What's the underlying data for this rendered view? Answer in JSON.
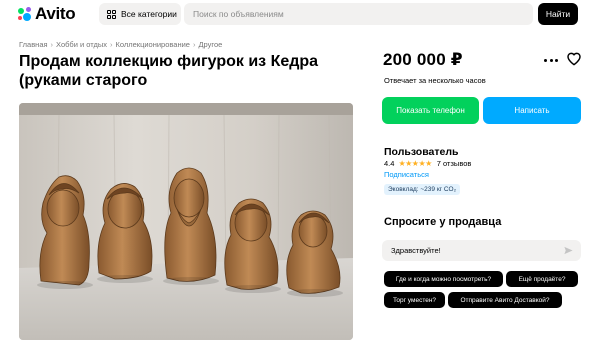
{
  "header": {
    "logo_text": "Avito",
    "categories_label": "Все категории",
    "search_placeholder": "Поиск по объявлениям",
    "find_label": "Найти"
  },
  "breadcrumbs": [
    "Главная",
    "Хобби и отдых",
    "Коллекционирование",
    "Другое"
  ],
  "listing": {
    "title": "Продам коллекцию фигурок из Кедра (руками старого"
  },
  "sidebar": {
    "price": "200 000 ₽",
    "response_time": "Отвечает за несколько часов",
    "show_phone_label": "Показать телефон",
    "write_label": "Написать",
    "seller": {
      "name": "Пользователь",
      "rating": "4.4",
      "stars": 4.4,
      "reviews": "7 отзывов",
      "subscribe_label": "Подписаться",
      "eco_badge": "Эковклад: ~239 кг CO₂"
    },
    "ask": {
      "title": "Спросите у продавца",
      "message_value": "Здравствуйте!",
      "quick_questions": [
        "Где и когда можно посмотреть?",
        "Ещё продаёте?",
        "Торг уместен?",
        "Отправите Авито Доставкой?"
      ]
    }
  },
  "colors": {
    "green_button": "#02d15c",
    "blue_button": "#00aaff",
    "star": "#ffb021",
    "link": "#0099f7"
  }
}
